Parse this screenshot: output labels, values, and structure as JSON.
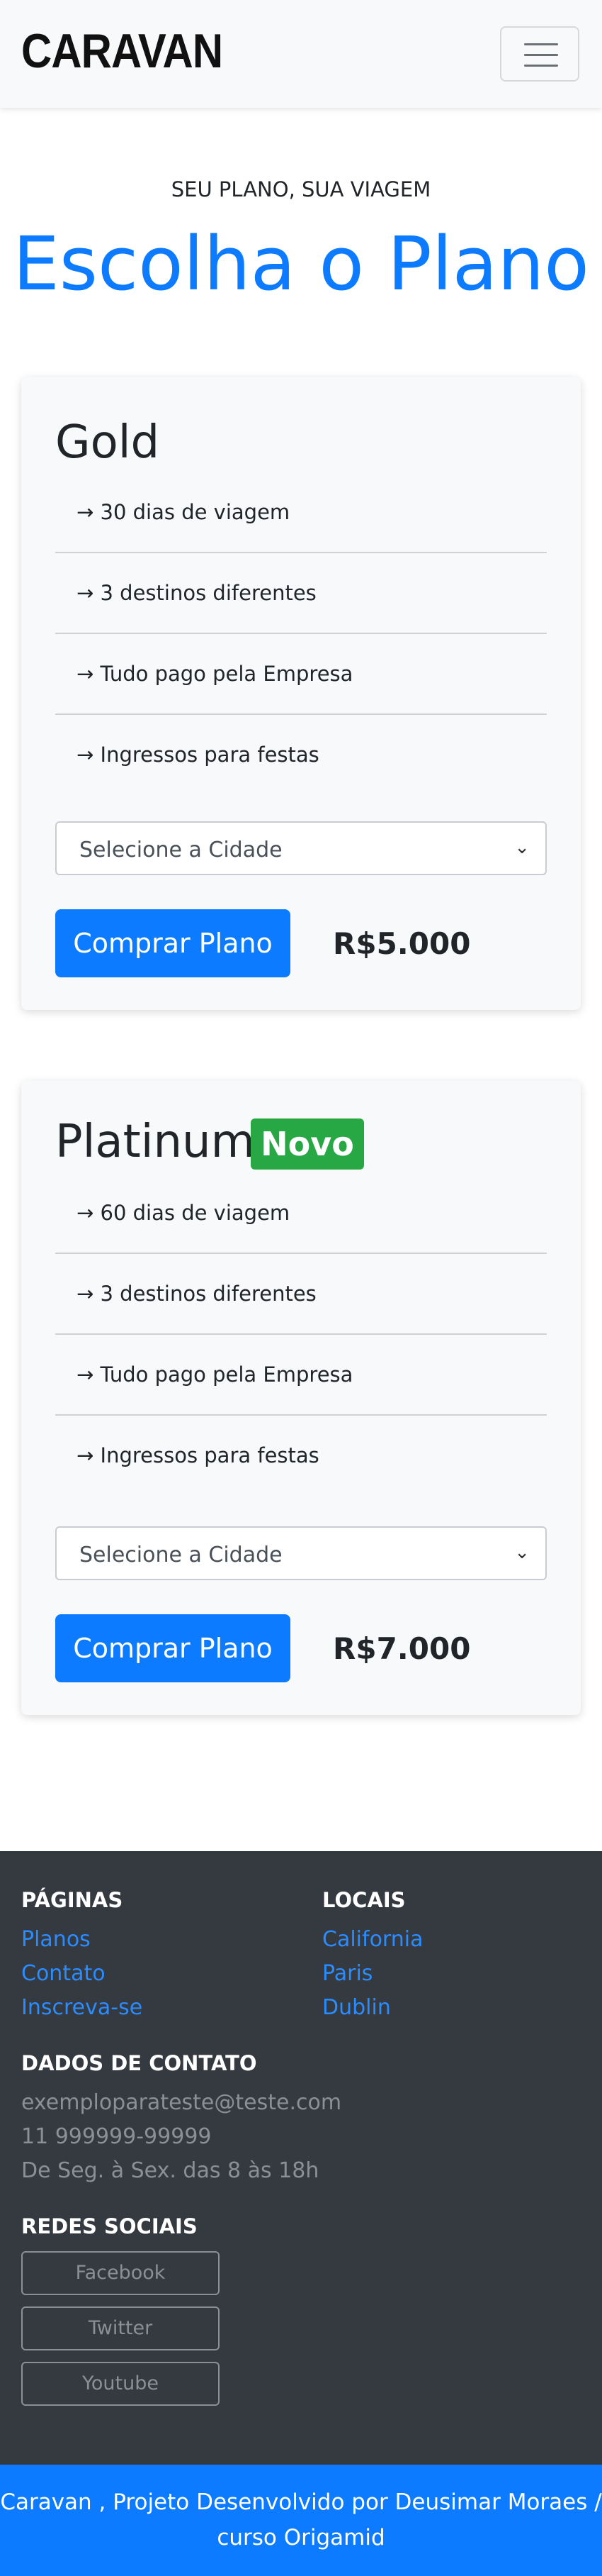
{
  "header": {
    "brand": "CARAVAN",
    "menu_icon": "hamburger-icon"
  },
  "intro": {
    "subtitle": "SEU PLANO, SUA VIAGEM",
    "title": "Escolha o Plano"
  },
  "plans": [
    {
      "name": "Gold",
      "badge": "",
      "features": [
        "→ 30 dias de viagem",
        "→ 3 destinos diferentes",
        "→ Tudo pago pela Empresa",
        "→ Ingressos para festas"
      ],
      "select_value": "Selecione a Cidade",
      "button": "Comprar Plano",
      "price": "R$5.000"
    },
    {
      "name": "Platinum",
      "badge": "Novo",
      "features": [
        "→ 60 dias de viagem",
        "→ 3 destinos diferentes",
        "→ Tudo pago pela Empresa",
        "→ Ingressos para festas"
      ],
      "select_value": "Selecione a Cidade",
      "button": "Comprar Plano",
      "price": "R$7.000"
    }
  ],
  "footer": {
    "pages_heading": "PÁGINAS",
    "pages": [
      "Planos",
      "Contato",
      "Inscreva-se"
    ],
    "places_heading": "LOCAIS",
    "places": [
      "California",
      "Paris",
      "Dublin"
    ],
    "contact_heading": "DADOS DE CONTATO",
    "contact": [
      "exemploparateste@teste.com",
      "11 999999-99999",
      "De Seg. à Sex. das 8 às 18h"
    ],
    "social_heading": "REDES SOCIAIS",
    "social": [
      "Facebook",
      "Twitter",
      "Youtube"
    ]
  },
  "copyright": {
    "line1": "Caravan , Projeto Desenvolvido por Deusimar Moraes /",
    "line2": "curso Origamid"
  },
  "colors": {
    "primary": "#0d7bff",
    "badge": "#28a745",
    "footer_bg": "#343a40",
    "card_bg": "#f8f9fa"
  }
}
